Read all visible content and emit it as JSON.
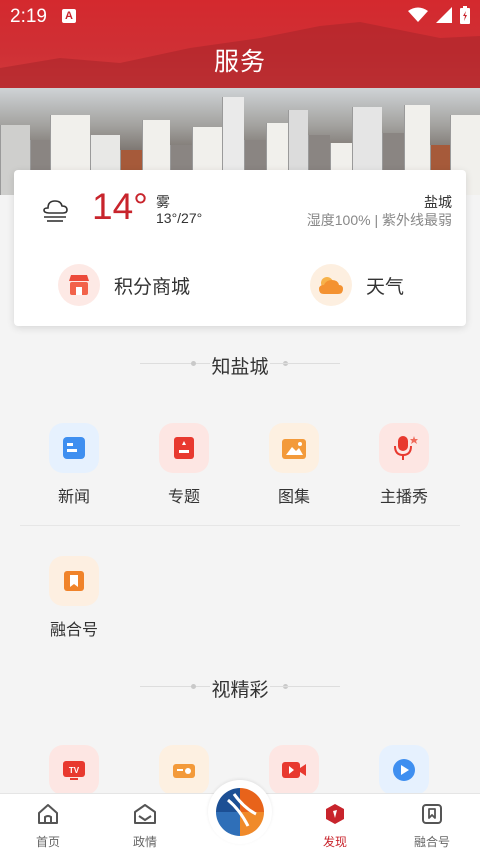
{
  "status_bar": {
    "time": "2:19"
  },
  "header": {
    "title": "服务"
  },
  "weather": {
    "temperature": "14°",
    "condition": "雾",
    "range": "13°/27°",
    "city": "盐城",
    "detail": "湿度100% | 紫外线最弱"
  },
  "quick_links": [
    {
      "label": "积分商城",
      "icon": "shop-icon"
    },
    {
      "label": "天气",
      "icon": "cloud-icon"
    }
  ],
  "sections": [
    {
      "title": "知盐城",
      "items": [
        {
          "label": "新闻",
          "icon": "news-icon",
          "color": "#3f8ff0",
          "bg": "#e6f1fe"
        },
        {
          "label": "专题",
          "icon": "topic-icon",
          "color": "#e8392f",
          "bg": "#fde6e3"
        },
        {
          "label": "图集",
          "icon": "gallery-icon",
          "color": "#f39a3a",
          "bg": "#fdf0e1"
        },
        {
          "label": "主播秀",
          "icon": "mic-icon",
          "color": "#e8392f",
          "bg": "#fde6e3"
        },
        {
          "label": "融合号",
          "icon": "bookmark-icon",
          "color": "#f0832a",
          "bg": "#fdefe1"
        }
      ]
    },
    {
      "title": "视精彩",
      "items": [
        {
          "label": "",
          "icon": "tv-icon",
          "color": "#e8392f",
          "bg": "#fde6e3"
        },
        {
          "label": "",
          "icon": "radio-icon",
          "color": "#f39a3a",
          "bg": "#fdf0e1"
        },
        {
          "label": "",
          "icon": "video-icon",
          "color": "#e8392f",
          "bg": "#fde6e3"
        },
        {
          "label": "",
          "icon": "play-icon",
          "color": "#3f8ff0",
          "bg": "#e6f1fe"
        }
      ]
    }
  ],
  "tabbar": [
    {
      "label": "首页",
      "icon": "home-icon",
      "active": false
    },
    {
      "label": "政情",
      "icon": "government-icon",
      "active": false
    },
    {
      "label": "发现",
      "icon": "discover-icon",
      "active": true
    },
    {
      "label": "融合号",
      "icon": "bookmark-icon",
      "active": false
    }
  ],
  "colors": {
    "brand": "#c8242c"
  }
}
